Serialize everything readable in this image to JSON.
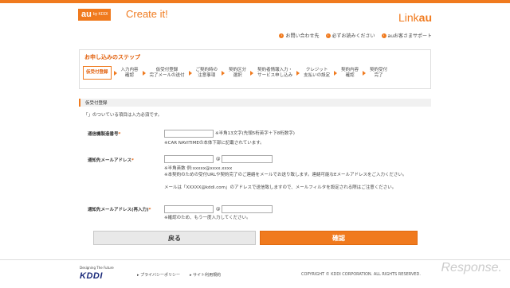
{
  "header": {
    "au_logo": "au",
    "au_logo_sub": "by KDDI",
    "tagline": "Create it!",
    "service_logo_prefix": "Link",
    "service_logo_suffix": "au",
    "links": [
      {
        "icon": "circle-arrow-icon",
        "label": "お問い合わせ先"
      },
      {
        "icon": "circle-arrow-icon",
        "label": "必ずお読みください"
      },
      {
        "icon": "circle-arrow-icon",
        "label": "auお客さまサポート"
      }
    ]
  },
  "steps": {
    "title": "お申し込みのステップ",
    "items": [
      {
        "label": "仮受付登録",
        "active": true
      },
      {
        "label": "入力内容\n確認",
        "active": false
      },
      {
        "label": "仮受付登録\n完了メールの送付",
        "active": false
      },
      {
        "label": "ご契約時の\n注意事項",
        "active": false
      },
      {
        "label": "契約区分\n選択",
        "active": false
      },
      {
        "label": "契約者情報入力・\nサービス申し込み",
        "active": false
      },
      {
        "label": "クレジット\n支払いの設定",
        "active": false
      },
      {
        "label": "契約内容\n確認",
        "active": false
      },
      {
        "label": "契約受付\n完了",
        "active": false
      }
    ]
  },
  "form": {
    "section_title": "仮受付登録",
    "required_note": "「」のついている項目は入力必須です。",
    "fields": {
      "device_serial": {
        "label": "通信機製造番号",
        "req": "*",
        "hint1": "※半角13文字(先頭5桁英字＋下8桁数字)",
        "hint2": "※CAR NAVITIMEの本体下部に記載されています。"
      },
      "email": {
        "label": "通知先メールアドレス",
        "req": "*",
        "at": "@",
        "hint1": "※半角英数 例:xxxxx@xxxx.xxxx",
        "hint2": "※本契約のための受付URLや契約完了のご連絡をメールでお送り致します。連絡可能なEメールアドレスをご入力ください。",
        "hint3": "メールは「XXXXX@kddi.com」のアドレスで送信致しますので、メールフィルタを設定される際はご注意ください。"
      },
      "email_confirm": {
        "label": "通知先メールアドレス(再入力)",
        "req": "*",
        "at": "@",
        "hint1": "※確認のため、もう一度入力してください。"
      }
    },
    "back_label": "戻る",
    "confirm_label": "確認"
  },
  "footer": {
    "designing": "Designing The Future",
    "kddi_logo": "KDDI",
    "links": [
      "プライバシーポリシー",
      "サイト利用規約"
    ],
    "copyright": "COPYRIGHT © KDDI CORPORATION. ALL RIGHTS RESERVED.",
    "watermark": "Response."
  },
  "colors": {
    "accent": "#f07a1e",
    "kddi_blue": "#1a2a7a"
  }
}
